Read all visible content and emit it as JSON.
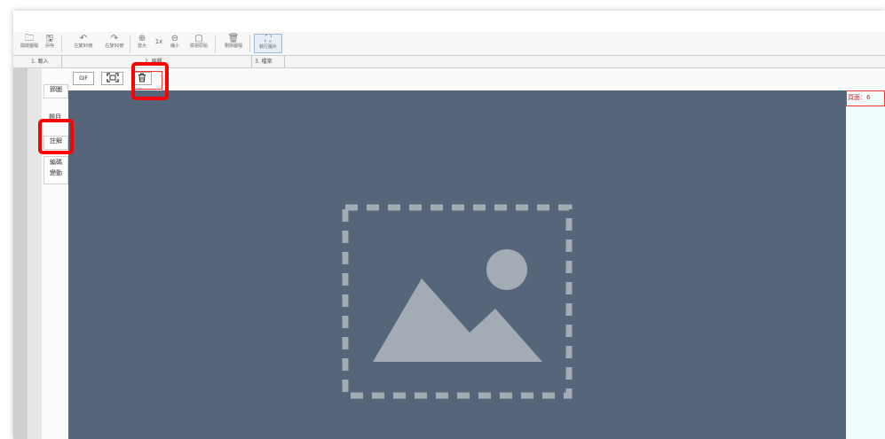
{
  "window": {
    "title": ""
  },
  "toolbar": {
    "buttons": [
      {
        "label": "開啟圖檔",
        "icon": "folder-icon"
      },
      {
        "label": "另存",
        "icon": "save-icon"
      },
      {
        "label": "左旋90度",
        "icon": "rotate-left-icon"
      },
      {
        "label": "右旋90度",
        "icon": "rotate-right-icon"
      },
      {
        "label": "放大",
        "icon": "zoom-in-icon"
      },
      {
        "label": "1x",
        "icon": ""
      },
      {
        "label": "縮小",
        "icon": "zoom-out-icon"
      },
      {
        "label": "檢視原始",
        "icon": "original-view-icon"
      },
      {
        "label": "刪除圖檔",
        "icon": "trash-icon"
      },
      {
        "label": "執行圖片",
        "icon": "run-image-icon"
      }
    ]
  },
  "sections": [
    {
      "label": "1. 載入"
    },
    {
      "label": "2. 編輯"
    },
    {
      "label": "3. 檔案"
    }
  ],
  "side_tabs": [
    {
      "label": "節圖"
    },
    {
      "label": "題目"
    },
    {
      "label": "註解"
    },
    {
      "label": "編碼"
    },
    {
      "label": "變動"
    }
  ],
  "mini_toolbar": {
    "buttons": [
      {
        "label": "GIF",
        "icon": ""
      },
      {
        "label": "",
        "icon": "qr-scan-icon"
      },
      {
        "label": "",
        "icon": "trash-icon"
      }
    ]
  },
  "canvas": {
    "placeholder_icon": "image-placeholder-icon",
    "background_color": "#566579",
    "icon_color": "#a3abb5"
  },
  "right_panel": {
    "label": "頁面：6"
  },
  "highlight_color": "#ff0000"
}
